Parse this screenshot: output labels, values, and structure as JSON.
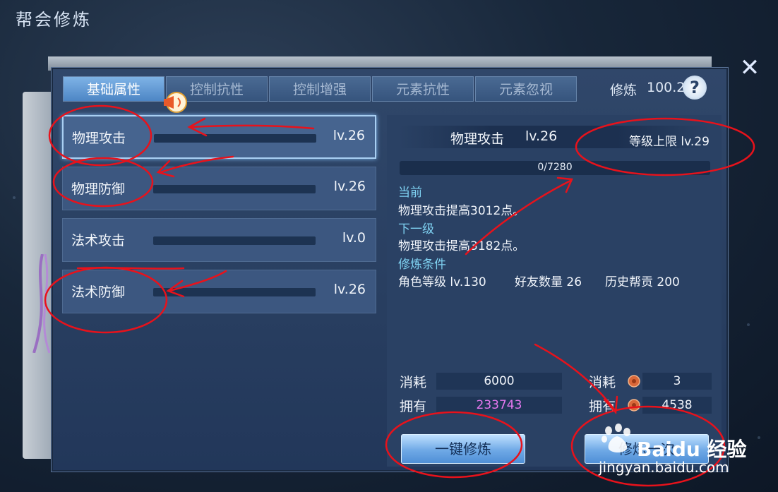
{
  "window": {
    "title": "帮会修炼"
  },
  "tabs": [
    {
      "label": "基础属性",
      "active": true
    },
    {
      "label": "控制抗性",
      "active": false
    },
    {
      "label": "控制增强",
      "active": false
    },
    {
      "label": "元素抗性",
      "active": false
    },
    {
      "label": "元素忽视",
      "active": false
    }
  ],
  "xiulian": {
    "label": "修炼",
    "value": "100.2"
  },
  "help_icon": "?",
  "attributes": [
    {
      "name": "物理攻击",
      "level": "lv.26",
      "selected": true
    },
    {
      "name": "物理防御",
      "level": "lv.26",
      "selected": false
    },
    {
      "name": "法术攻击",
      "level": "lv.0",
      "selected": false
    },
    {
      "name": "法术防御",
      "level": "lv.26",
      "selected": false
    }
  ],
  "detail": {
    "name": "物理攻击",
    "level": "lv.26",
    "cap": "等级上限 lv.29",
    "progress": "0/7280",
    "progress_fraction": 0,
    "current_label": "当前",
    "current_text": "物理攻击提高3012点。",
    "next_label": "下一级",
    "next_text": "物理攻击提高3182点。",
    "cond_label": "修炼条件",
    "conditions": [
      "角色等级 lv.130",
      "好友数量 26",
      "历史帮贡 200"
    ]
  },
  "costs": {
    "consume_label": "消耗",
    "own_label": "拥有",
    "scroll_cost": "6000",
    "scroll_own": "233743",
    "coin_cost": "3",
    "coin_own": "4538"
  },
  "buttons": {
    "one_key": "一键修炼",
    "once": "修炼一次"
  },
  "watermark": {
    "text": "Baidu 经验",
    "url": "jingyan.baidu.com"
  },
  "colors": {
    "accent": "#7fd2f2",
    "pink_value": "#e678f0",
    "annotation": "#e8121b"
  }
}
